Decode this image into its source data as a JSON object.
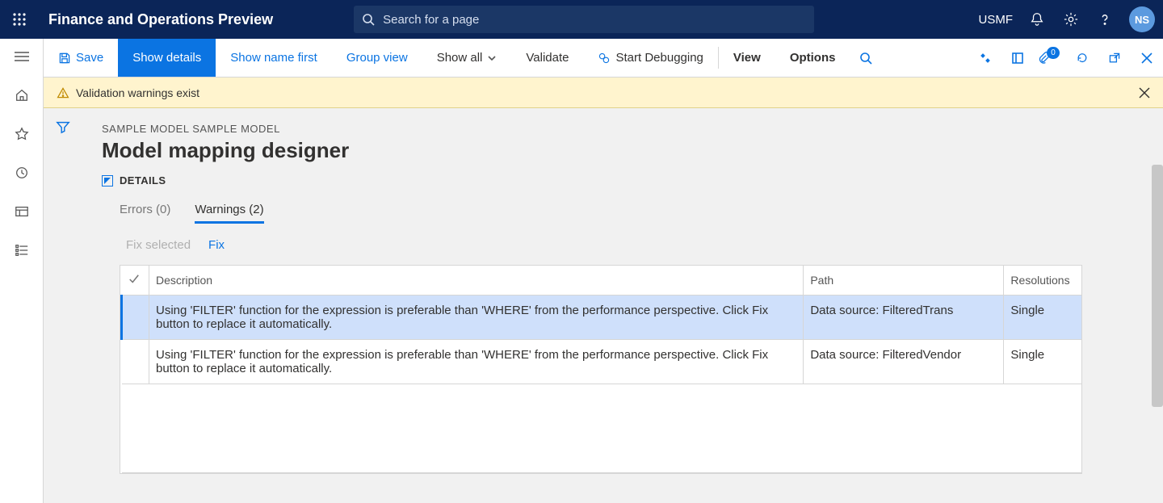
{
  "header": {
    "title": "Finance and Operations Preview",
    "search_placeholder": "Search for a page",
    "company": "USMF",
    "avatar_initials": "NS"
  },
  "actionbar": {
    "save": "Save",
    "show_details": "Show details",
    "show_name_first": "Show name first",
    "group_view": "Group view",
    "show_all": "Show all",
    "validate": "Validate",
    "start_debugging": "Start Debugging",
    "view": "View",
    "options": "Options",
    "attachment_badge": "0"
  },
  "warning_strip": {
    "text": "Validation warnings exist"
  },
  "page": {
    "breadcrumb": "SAMPLE MODEL SAMPLE MODEL",
    "title": "Model mapping designer",
    "section": "DETAILS",
    "tabs": {
      "errors": "Errors (0)",
      "warnings": "Warnings (2)"
    },
    "subactions": {
      "fix_selected": "Fix selected",
      "fix": "Fix"
    }
  },
  "grid": {
    "columns": {
      "description": "Description",
      "path": "Path",
      "resolutions": "Resolutions"
    },
    "rows": [
      {
        "description": "Using 'FILTER' function for the expression is preferable than 'WHERE' from the performance perspective. Click Fix button to replace it automatically.",
        "path": "Data source: FilteredTrans",
        "resolutions": "Single",
        "selected": true
      },
      {
        "description": "Using 'FILTER' function for the expression is preferable than 'WHERE' from the performance perspective. Click Fix button to replace it automatically.",
        "path": "Data source: FilteredVendor",
        "resolutions": "Single",
        "selected": false
      }
    ]
  }
}
